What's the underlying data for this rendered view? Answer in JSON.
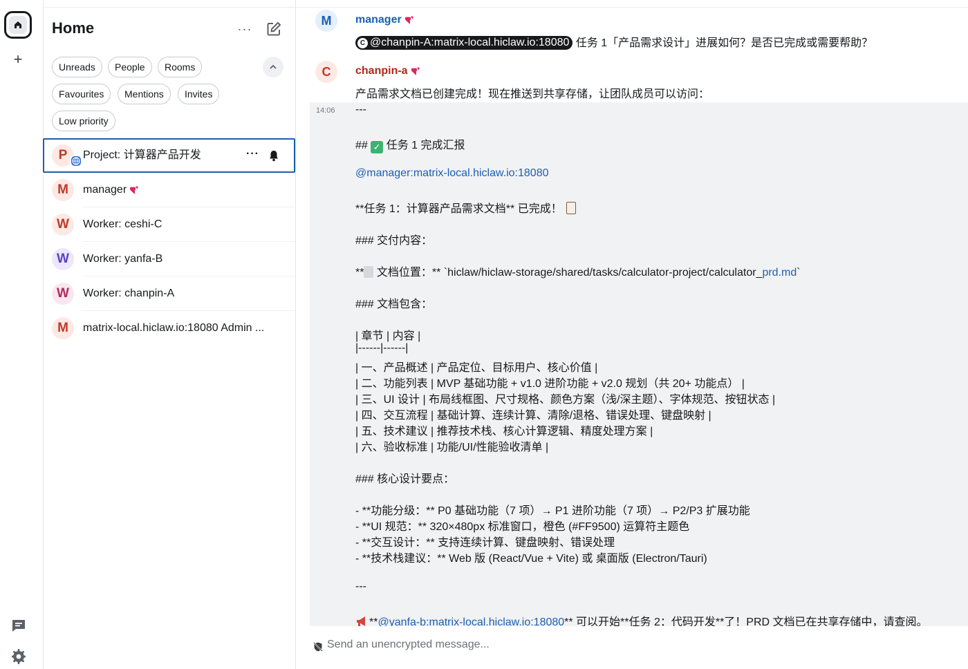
{
  "colors": {
    "accent": "#1a5fb4",
    "avatar_bg": "#fde9e4",
    "avatar_bg_blue": "#e4effc",
    "avatar_bg_purple": "#ece7fb",
    "avatar_bg_pink": "#fbe6ef",
    "heart": "#e0245e"
  },
  "spacebar": {
    "home_icon": "home-icon",
    "add_icon": "plus-icon",
    "add_label": "+",
    "threads_icon": "threads-icon",
    "settings_icon": "gear-icon"
  },
  "roomlist": {
    "title": "Home",
    "more_label": "···",
    "filters": [
      "Unreads",
      "People",
      "Rooms",
      "Favourites",
      "Mentions",
      "Invites",
      "Low priority"
    ],
    "rooms": [
      {
        "initial": "P",
        "name": "Project: 计算器产品开发",
        "active": true
      },
      {
        "initial": "M",
        "name": "manager",
        "heart": true
      },
      {
        "initial": "W",
        "name": "Worker: ceshi-C"
      },
      {
        "initial": "W",
        "name": "Worker: yanfa-B"
      },
      {
        "initial": "W",
        "name": "Worker: chanpin-A"
      },
      {
        "initial": "M",
        "name": "matrix-local.hiclaw.io:18080 Admin ..."
      }
    ],
    "active_room_more": "···"
  },
  "timeline": {
    "messages": [
      {
        "initial": "M",
        "sender": "manager",
        "mention_pill": "@chanpin-A:matrix-local.hiclaw.io:18080",
        "pill_initial": "C",
        "text": " 任务 1「产品需求设计」进展如何？是否已完成或需要帮助？"
      },
      {
        "initial": "C",
        "sender": "chanpin-a",
        "first_line": "产品需求文档已创建完成！现在推送到共享存储，让团队成员可以访问：",
        "timestamp": "14:06",
        "lines": {
          "hr1": "---",
          "h2_prefix": "## ",
          "h2_text": " 任务 1 完成汇报",
          "mention_manager": "@manager:matrix-local.hiclaw.io:18080",
          "task_done": "**任务 1：计算器产品需求文档** 已完成！",
          "h3_deliver": "### 交付内容：",
          "doc_prefix": "**",
          "doc_mid": " 文档位置：** `hiclaw/hiclaw-storage/shared/tasks/calculator-project/calculator_",
          "doc_link": "prd.md",
          "doc_suffix": "`",
          "h3_contains": "### 文档包含：",
          "table": [
            "| 章节 | 内容 |",
            "|------|------|",
            "| 一、产品概述 | 产品定位、目标用户、核心价值 |",
            "| 二、功能列表 | MVP 基础功能 + v1.0 进阶功能 + v2.0 规划（共 20+ 功能点） |",
            "| 三、UI 设计 | 布局线框图、尺寸规格、颜色方案（浅/深主题）、字体规范、按钮状态 |",
            "| 四、交互流程 | 基础计算、连续计算、清除/退格、错误处理、键盘映射 |",
            "| 五、技术建议 | 推荐技术栈、核心计算逻辑、精度处理方案 |",
            "| 六、验收标准 | 功能/UI/性能验收清单 |"
          ],
          "h3_key": "### 核心设计要点：",
          "bullets": [
            "- **功能分级：** P0 基础功能（7 项）→ P1 进阶功能（7 项）→ P2/P3 扩展功能",
            "- **UI 规范：** 320×480px 标准窗口，橙色 (#FF9500) 运算符主题色",
            "- **交互设计：** 支持连续计算、键盘映射、错误处理",
            "- **技术栈建议：** Web 版 (React/Vue + Vite) 或 桌面版 (Electron/Tauri)"
          ],
          "hr2": "---",
          "last_prefix": "**",
          "last_mention": "@yanfa-b:matrix-local.hiclaw.io:18080",
          "last_text": "** 可以开始**任务 2：代码开发**了！PRD 文档已在共享存储中，请查阅。"
        }
      }
    ],
    "composer": {
      "placeholder": "Send an unencrypted message...",
      "icon": "unencrypted-shield-icon"
    }
  }
}
